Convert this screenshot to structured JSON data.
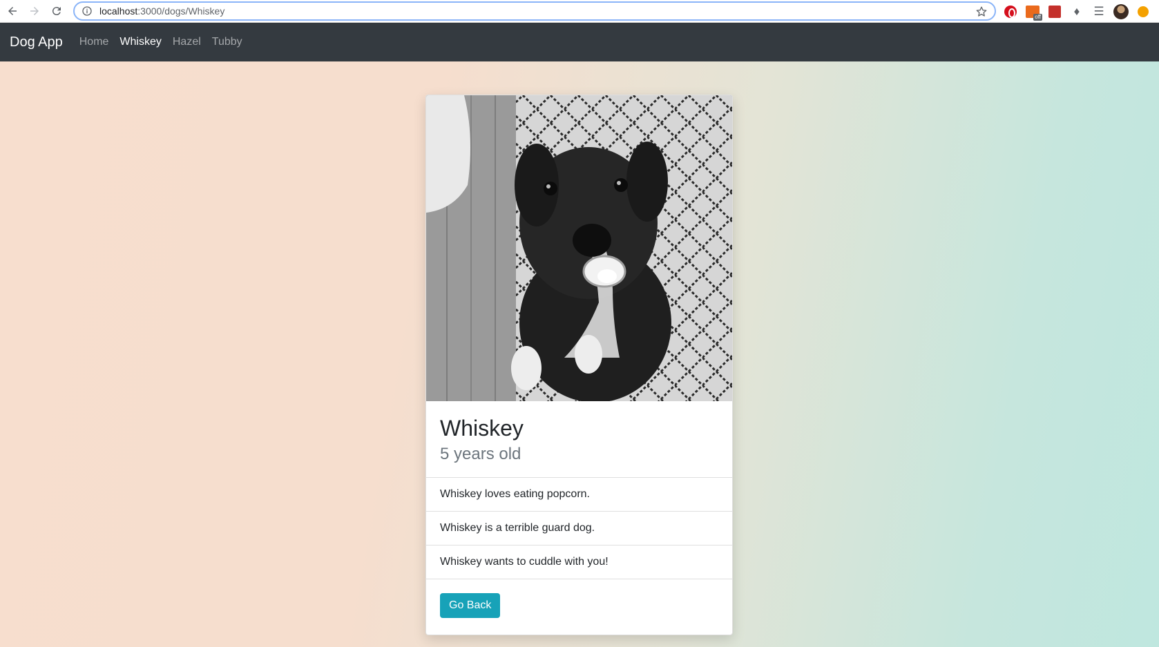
{
  "browser": {
    "url_host": "localhost",
    "url_path": ":3000/dogs/Whiskey",
    "extensions": [
      "opera-icon",
      "off-extension-icon",
      "photo-extension-icon",
      "puzzle-icon",
      "media-list-icon",
      "avatar",
      "update-icon"
    ],
    "off_badge": "off"
  },
  "navbar": {
    "brand": "Dog App",
    "links": [
      {
        "label": "Home",
        "active": false
      },
      {
        "label": "Whiskey",
        "active": true
      },
      {
        "label": "Hazel",
        "active": false
      },
      {
        "label": "Tubby",
        "active": false
      }
    ]
  },
  "dog": {
    "name": "Whiskey",
    "age": "5 years old",
    "facts": [
      "Whiskey loves eating popcorn.",
      "Whiskey is a terrible guard dog.",
      "Whiskey wants to cuddle with you!"
    ],
    "back_button": "Go Back"
  },
  "colors": {
    "navbar": "#343a40",
    "button": "#17a2b8",
    "gradient_left": "#f7dece",
    "gradient_right": "#bfe7df"
  }
}
